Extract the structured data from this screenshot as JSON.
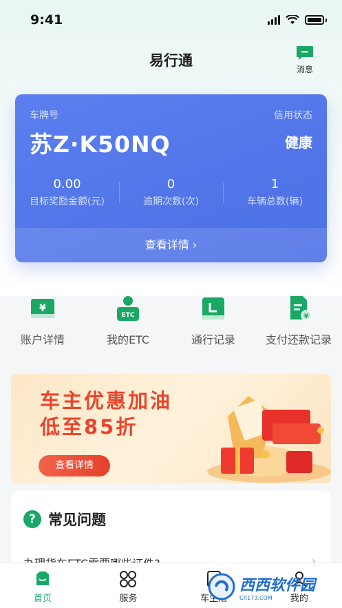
{
  "status_bar": {
    "time": "9:41"
  },
  "header": {
    "title": "易行通",
    "message_label": "消息"
  },
  "card": {
    "plate_label": "车牌号",
    "plate": "苏Z·K50NQ",
    "credit_label": "信用状态",
    "credit_status": "健康",
    "stats": [
      {
        "value": "0.00",
        "label": "目标奖励金额(元)"
      },
      {
        "value": "0",
        "label": "逾期次数(次)"
      },
      {
        "value": "1",
        "label": "车辆总数(辆)"
      }
    ],
    "details_label": "查看详情 ›"
  },
  "quick_actions": [
    {
      "label": "账户详情",
      "icon": "yuan-card-icon"
    },
    {
      "label": "我的ETC",
      "icon": "etc-user-icon"
    },
    {
      "label": "通行记录",
      "icon": "record-icon"
    },
    {
      "label": "支付还款记录",
      "icon": "payment-doc-icon"
    }
  ],
  "banner": {
    "line1": "车主优惠加油",
    "line2": "低至85折",
    "button_label": "查看详情"
  },
  "faq": {
    "title": "常见问题",
    "first_item": "办理货车ETC需要哪些证件?"
  },
  "tabs": [
    {
      "label": "首页",
      "active": true
    },
    {
      "label": "服务",
      "active": false
    },
    {
      "label": "车生活",
      "active": false
    },
    {
      "label": "我的",
      "active": false
    }
  ],
  "watermark": {
    "text": "西西软件园",
    "sub": "CR173.COM"
  },
  "colors": {
    "accent": "#1aa865",
    "card": "#4f73e8",
    "banner_text": "#e8452c"
  }
}
